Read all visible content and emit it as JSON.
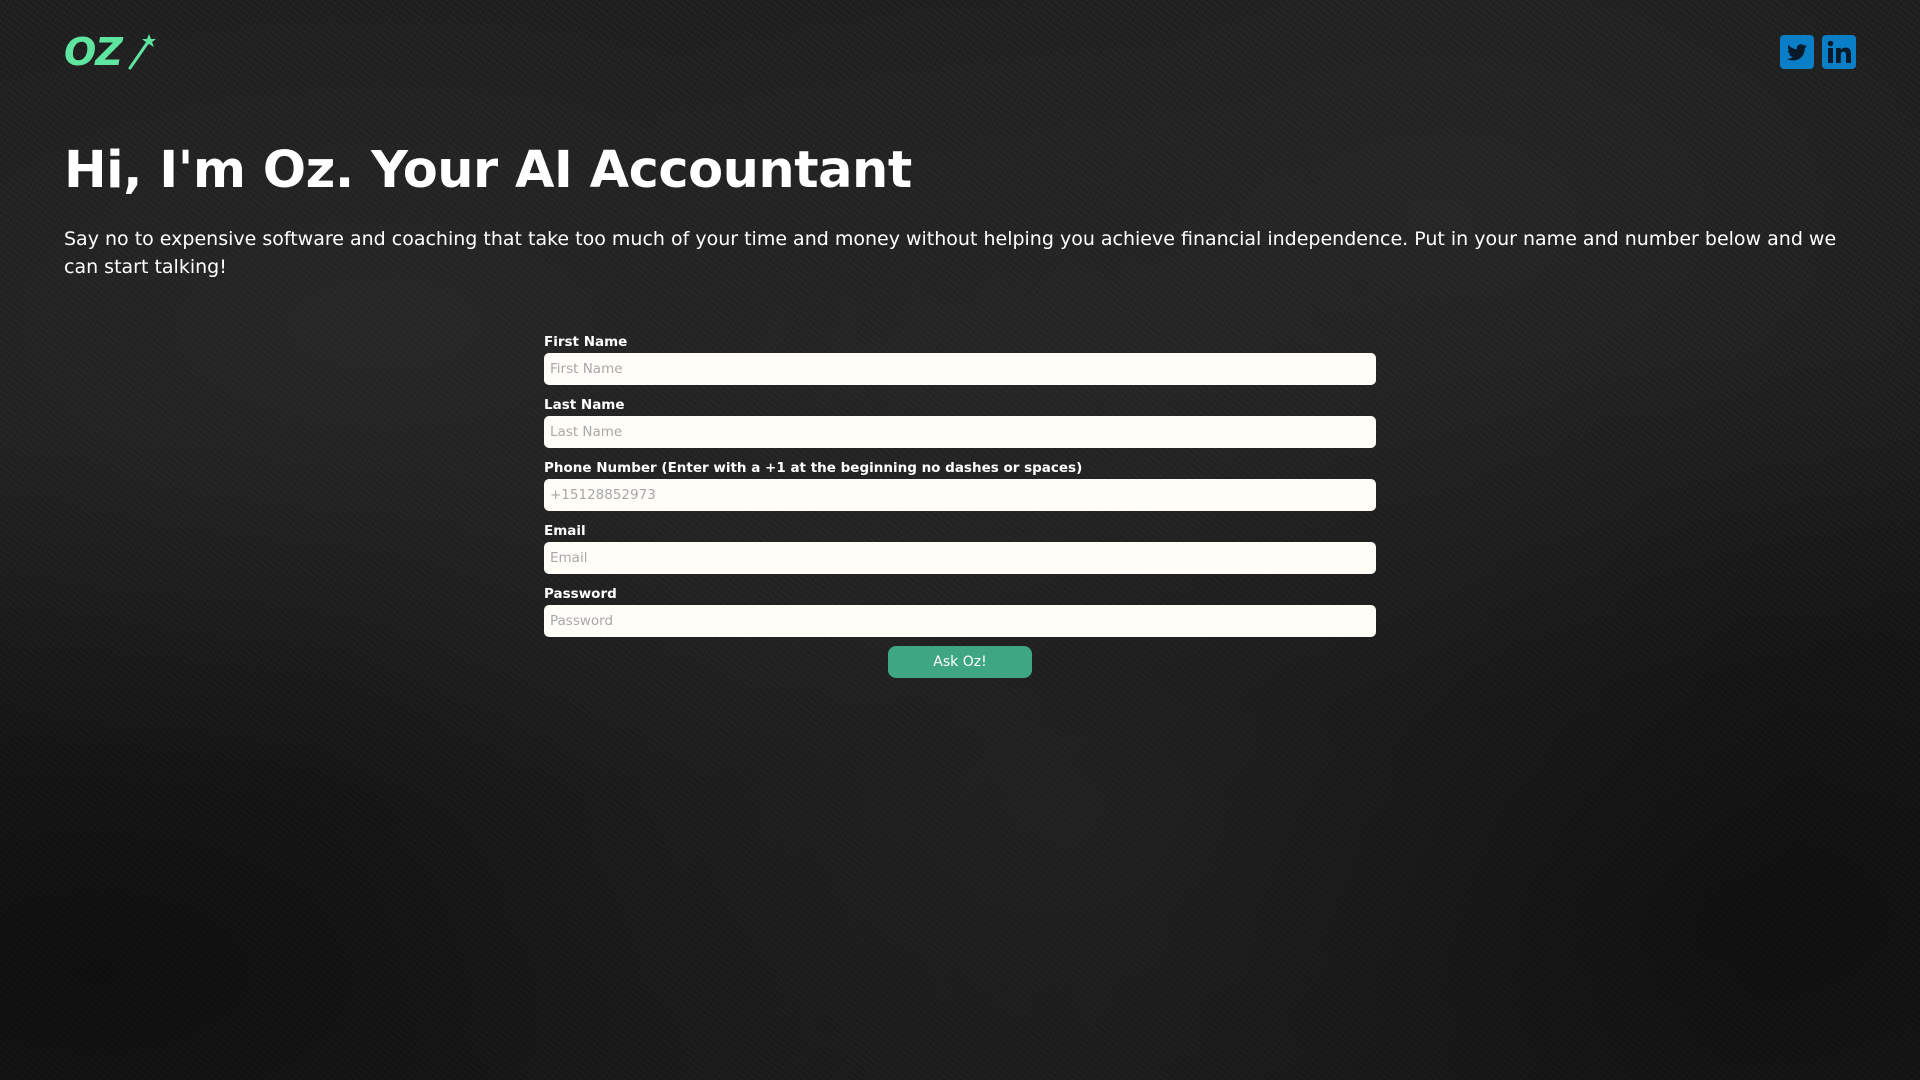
{
  "header": {
    "logo_text": "OZ",
    "logo_icon": "magic-wand-icon",
    "social": [
      {
        "name": "twitter",
        "icon": "twitter-icon"
      },
      {
        "name": "linkedin",
        "icon": "linkedin-icon"
      }
    ]
  },
  "hero": {
    "title": "Hi, I'm Oz. Your AI Accountant",
    "description": "Say no to expensive software and coaching that take too much of your time and money without helping you achieve financial independence. Put in your name and number below and we can start talking!"
  },
  "form": {
    "fields": [
      {
        "label": "First Name",
        "placeholder": "First Name",
        "value": ""
      },
      {
        "label": "Last Name",
        "placeholder": "Last Name",
        "value": ""
      },
      {
        "label": "Phone Number (Enter with a +1 at the beginning no dashes or spaces)",
        "placeholder": "+15128852973",
        "value": ""
      },
      {
        "label": "Email",
        "placeholder": "Email",
        "value": ""
      },
      {
        "label": "Password",
        "placeholder": "Password",
        "value": ""
      }
    ],
    "submit_label": "Ask Oz!"
  },
  "colors": {
    "accent_green": "#3fa683",
    "logo_green": "#5ee6a0",
    "social_blue": "#0a7fc7",
    "input_background": "#fffdf8"
  }
}
